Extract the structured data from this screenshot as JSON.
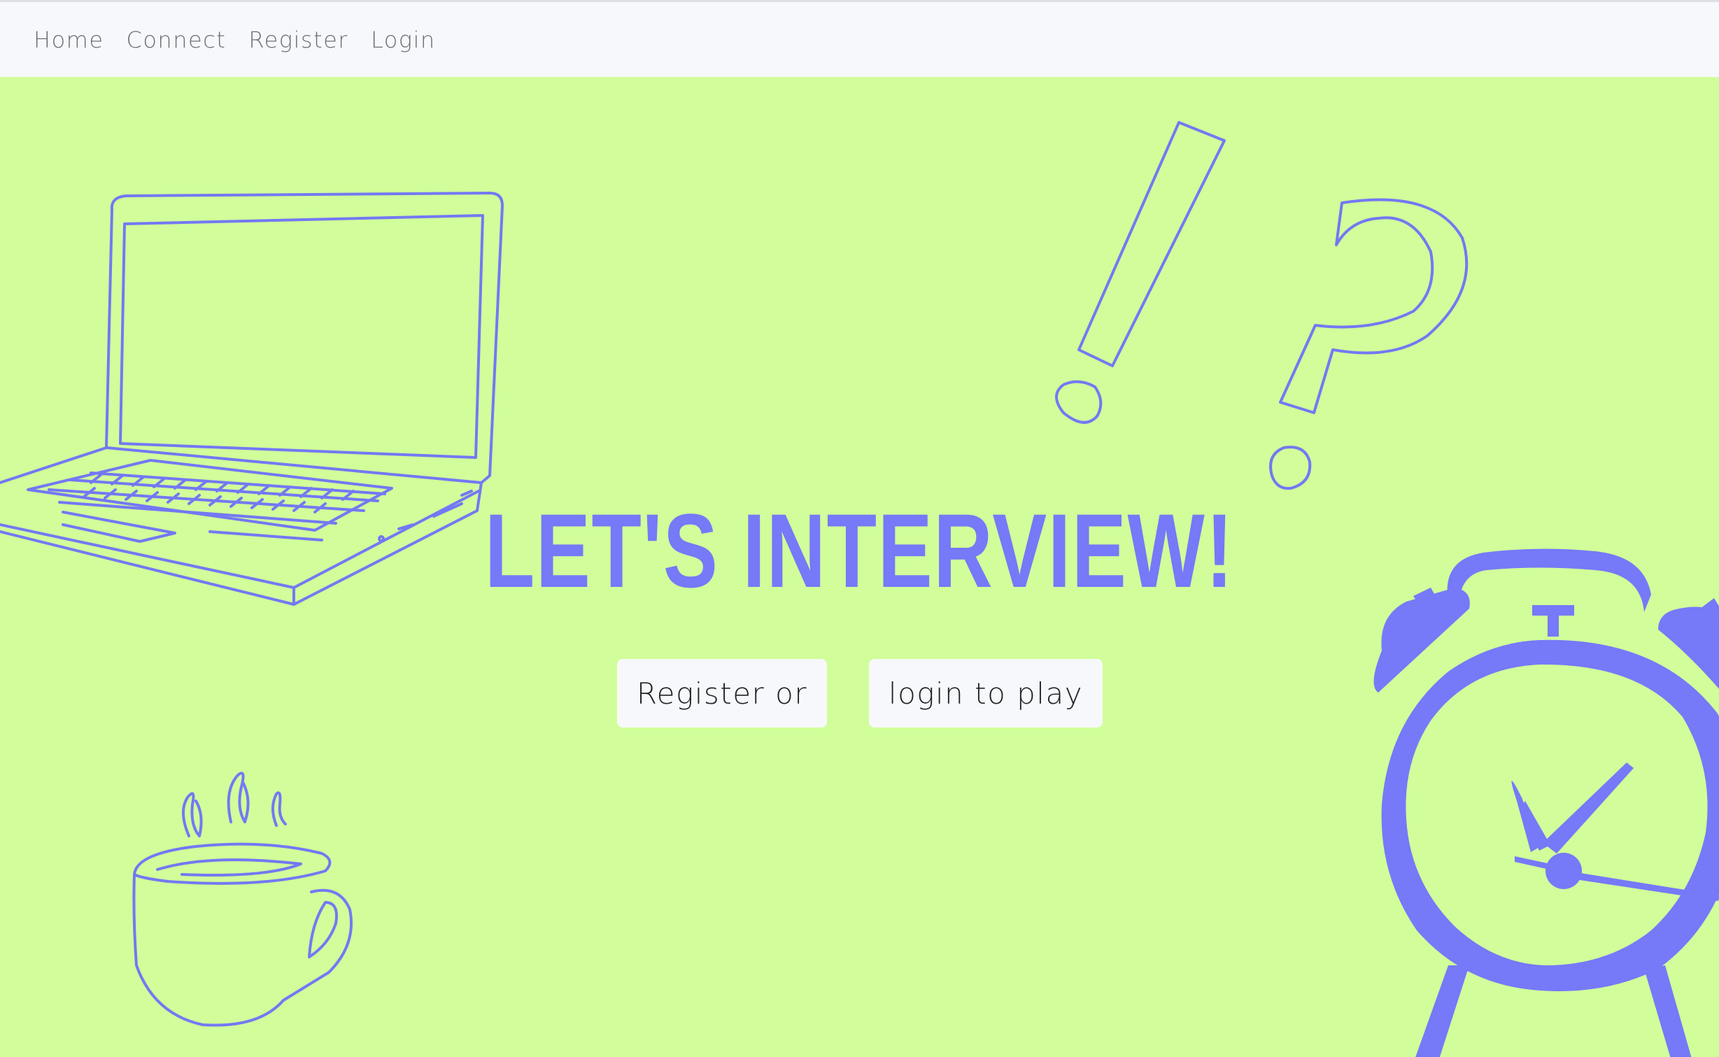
{
  "nav": {
    "links": [
      "Home",
      "Connect",
      "Register",
      "Login"
    ]
  },
  "hero": {
    "title": "LET'S INTERVIEW!",
    "register_button": "Register or",
    "login_button": "login to play"
  },
  "colors": {
    "background": "#d1fe9a",
    "accent": "#7679f8",
    "navbar": "#f7f8fb",
    "button": "#f7f8fb"
  },
  "icons": [
    "laptop-icon",
    "exclamation-icon",
    "question-mark-icon",
    "coffee-cup-icon",
    "alarm-clock-icon"
  ]
}
